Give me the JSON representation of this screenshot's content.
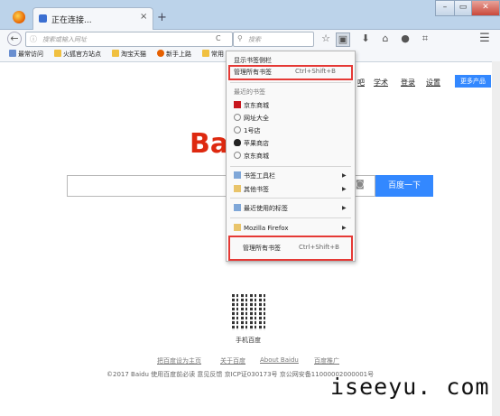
{
  "window": {
    "tab_title": "正在连接...",
    "tab_close": "×",
    "new_tab": "+",
    "min": "–",
    "max": "▭",
    "close": "✕"
  },
  "navbar": {
    "back": "←",
    "url_placeholder": "搜索或输入网址",
    "reload": "C",
    "search_placeholder": "搜索",
    "toolbar_icons": [
      "☆",
      "▣",
      "⬇",
      "⌂",
      "●",
      "⌗",
      "☰"
    ]
  },
  "bookmarks_bar": [
    "最常访问",
    "火狐官方站点",
    "淘宝天猫",
    "新手上路",
    "常用"
  ],
  "baidu": {
    "top_links": [
      "吧",
      "学术",
      "登录",
      "设置"
    ],
    "more_products": "更多产品",
    "logo": "Bai",
    "search_button": "百度一下",
    "qr_label": "手机百度",
    "footer_links": [
      "把百度设为主页",
      "关于百度",
      "About Baidu",
      "百度推广"
    ],
    "footer_line": "©2017 Baidu 使用百度前必读 意见反馈 京ICP证030173号  京公网安备11000002000001号"
  },
  "menu": {
    "show_bookmarks_toolbar": "显示书签侧栏",
    "manage_all_top": "管理所有书签",
    "manage_all_top_shortcut": "Ctrl+Shift+B",
    "recent_header": "最近的书签",
    "recent": [
      "京东商城",
      "网址大全",
      "1号店",
      "苹果商店",
      "京东商城"
    ],
    "bookmarks_toolbar": "书签工具栏",
    "other_bookmarks": "其他书签",
    "recent_tags": "最近使用的标签",
    "mozilla_firefox": "Mozilla Firefox",
    "manage_all_bottom": "管理所有书签",
    "manage_all_bottom_shortcut": "Ctrl+Shift+B"
  },
  "watermark": "iseeyu. com",
  "colors": {
    "accent": "#3388ff",
    "highlight": "#e53935",
    "logo_red": "#de2910"
  }
}
